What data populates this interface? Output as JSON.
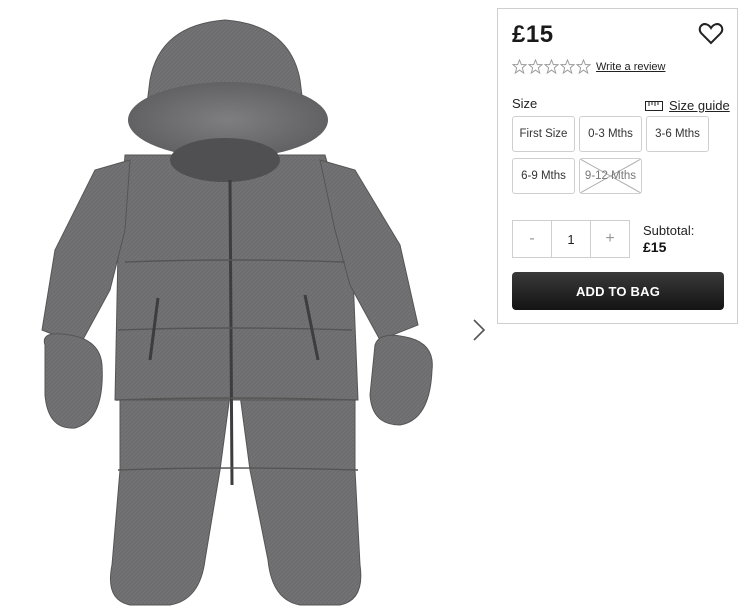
{
  "product": {
    "price": "£15",
    "image_alt": "Grey snowsuit"
  },
  "review": {
    "rating": 0,
    "max_rating": 5,
    "write_review_label": "Write a review"
  },
  "sizes": {
    "label": "Size",
    "guide_label": "Size guide",
    "options": [
      {
        "label": "First Size",
        "available": true
      },
      {
        "label": "0-3 Mths",
        "available": true
      },
      {
        "label": "3-6 Mths",
        "available": true
      },
      {
        "label": "6-9 Mths",
        "available": true
      },
      {
        "label": "9-12 Mths",
        "available": false
      }
    ]
  },
  "quantity": {
    "decrement": "-",
    "value": "1",
    "increment": "+"
  },
  "subtotal": {
    "label": "Subtotal:",
    "value": "£15"
  },
  "add_to_bag_label": "ADD TO BAG",
  "colors": {
    "button_dark": "#1a1a1a",
    "border": "#cfcfcf",
    "fabric": "#6e6e6e"
  }
}
